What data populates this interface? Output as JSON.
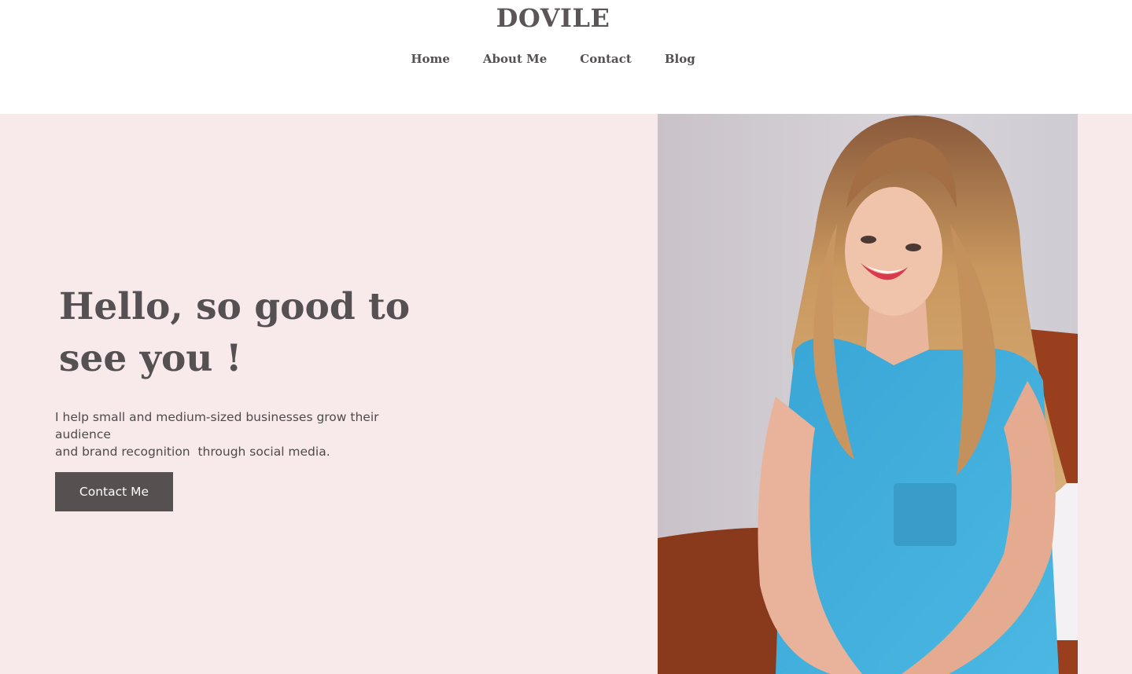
{
  "brand": {
    "name": "DOVILE"
  },
  "nav": {
    "home": "Home",
    "about": "About Me",
    "contact": "Contact",
    "blog": "Blog"
  },
  "hero": {
    "headline_line1": "Hello, so good to",
    "headline_line2": "see you !",
    "subtext_line1": "I help small and medium-sized businesses grow their audience",
    "subtext_line2": "and brand recognition  through social media.",
    "cta_label": "Contact Me"
  },
  "colors": {
    "hero_background": "#f8eaea",
    "text": "#555152",
    "button": "#565051",
    "button_text": "#ffffff"
  }
}
